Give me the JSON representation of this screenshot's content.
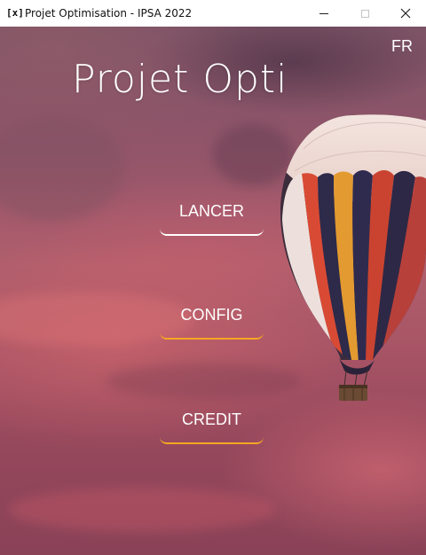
{
  "window": {
    "icon_glyph": "[x]",
    "icon_name": "app-x-icon",
    "title": "Projet Optimisation - IPSA 2022",
    "controls": {
      "minimize": "minimize-icon",
      "maximize": "maximize-icon",
      "close": "close-icon",
      "close_glyph": "✕"
    }
  },
  "screen": {
    "language": "FR",
    "title": "Projet Opti",
    "menu": {
      "launch_label": "LANCER",
      "config_label": "CONFIG",
      "credit_label": "CREDIT"
    }
  },
  "colors": {
    "primary_underline": "#ffffff",
    "accent_underline": "#f5a623",
    "text": "#ffffff"
  }
}
